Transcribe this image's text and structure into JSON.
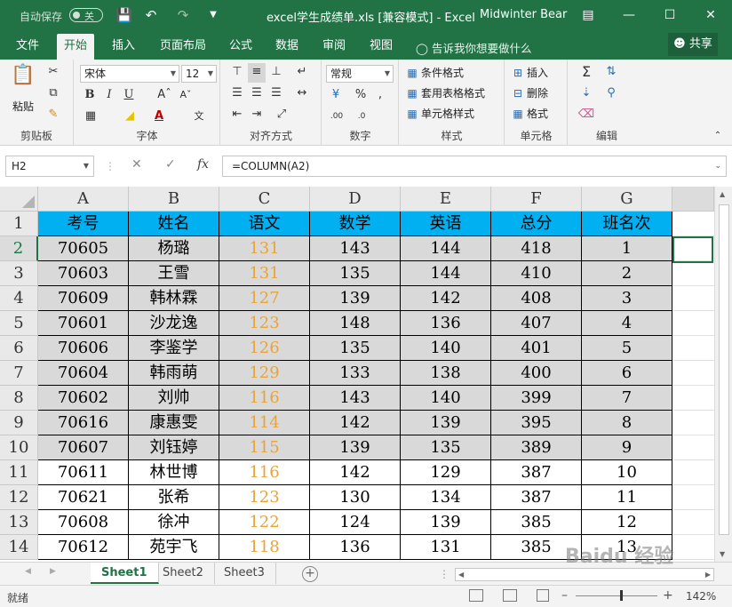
{
  "titlebar": {
    "autosave_label": "自动保存",
    "autosave_state": "关",
    "document_title": "excel学生成绩单.xls  [兼容模式]  -  Excel",
    "user_name": "Midwinter Bear",
    "icons": [
      "save-icon",
      "undo-icon",
      "redo-icon",
      "customize-icon",
      "ribbon-display-icon",
      "minimize-icon",
      "maximize-icon",
      "close-icon"
    ]
  },
  "ribbon_tabs": [
    "文件",
    "开始",
    "插入",
    "页面布局",
    "公式",
    "数据",
    "审阅",
    "视图"
  ],
  "active_tab": "开始",
  "tell_me": "告诉我你想要做什么",
  "share_label": "共享",
  "ribbon": {
    "clipboard": {
      "label": "剪贴板",
      "paste": "粘贴"
    },
    "font": {
      "label": "字体",
      "font_name": "宋体",
      "font_size": "12",
      "bold": "B",
      "italic": "I",
      "underline": "U"
    },
    "alignment": {
      "label": "对齐方式"
    },
    "number": {
      "label": "数字",
      "format": "常规"
    },
    "styles": {
      "label": "样式",
      "conditional": "条件格式",
      "table": "套用表格格式",
      "cell_styles": "单元格样式"
    },
    "cells": {
      "label": "单元格",
      "insert": "插入",
      "delete": "删除",
      "format": "格式"
    },
    "editing": {
      "label": "编辑"
    }
  },
  "formula_bar": {
    "name_box": "H2",
    "formula": "=COLUMN(A2)"
  },
  "columns": [
    "A",
    "B",
    "C",
    "D",
    "E",
    "F",
    "G"
  ],
  "rows": [
    [
      "考号",
      "姓名",
      "语文",
      "数学",
      "英语",
      "总分",
      "班名次"
    ],
    [
      "70605",
      "杨璐",
      "131",
      "143",
      "144",
      "418",
      "1"
    ],
    [
      "70603",
      "王雪",
      "131",
      "135",
      "144",
      "410",
      "2"
    ],
    [
      "70609",
      "韩林霖",
      "127",
      "139",
      "142",
      "408",
      "3"
    ],
    [
      "70601",
      "沙龙逸",
      "123",
      "148",
      "136",
      "407",
      "4"
    ],
    [
      "70606",
      "李鉴学",
      "126",
      "135",
      "140",
      "401",
      "5"
    ],
    [
      "70604",
      "韩雨萌",
      "129",
      "133",
      "138",
      "400",
      "6"
    ],
    [
      "70602",
      "刘帅",
      "116",
      "143",
      "140",
      "399",
      "7"
    ],
    [
      "70616",
      "康惠雯",
      "114",
      "142",
      "139",
      "395",
      "8"
    ],
    [
      "70607",
      "刘钰婷",
      "115",
      "139",
      "135",
      "389",
      "9"
    ],
    [
      "70611",
      "林世博",
      "116",
      "142",
      "129",
      "387",
      "10"
    ],
    [
      "70621",
      "张希",
      "123",
      "130",
      "134",
      "387",
      "11"
    ],
    [
      "70608",
      "徐冲",
      "122",
      "124",
      "139",
      "385",
      "12"
    ],
    [
      "70612",
      "苑宇飞",
      "118",
      "136",
      "131",
      "385",
      "13"
    ]
  ],
  "row_numbers": [
    "1",
    "2",
    "3",
    "4",
    "5",
    "6",
    "7",
    "8",
    "9",
    "10",
    "11",
    "12",
    "13",
    "14"
  ],
  "gray_rows": 9,
  "colors": {
    "header_fill": "#00B0F0",
    "gray_fill": "#D9D9D9",
    "chinese_score": "#E8A33A",
    "accent": "#217346"
  },
  "sheets": [
    "Sheet1",
    "Sheet2",
    "Sheet3"
  ],
  "active_sheet": "Sheet1",
  "status": {
    "ready": "就绪",
    "zoom": "142%"
  },
  "watermark": "Baidu 经验"
}
